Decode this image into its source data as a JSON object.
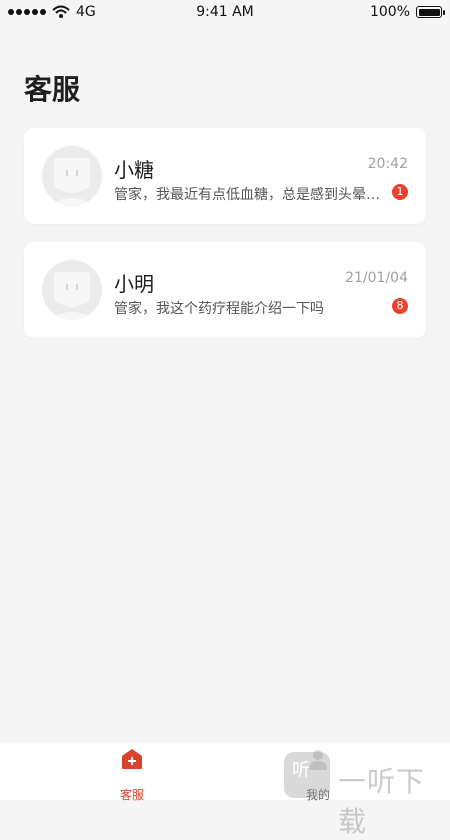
{
  "status_bar": {
    "carrier": "4G",
    "time": "9:41 AM",
    "battery_percent": "100%"
  },
  "header": {
    "title": "客服"
  },
  "conversations": [
    {
      "name": "小糖",
      "time": "20:42",
      "preview": "管家，我最近有点低血糖，总是感到头晕乏力",
      "unread": "1",
      "avatar_icon": "user-avatar-placeholder-icon"
    },
    {
      "name": "小明",
      "time": "21/01/04",
      "preview": "管家，我这个药疗程能介绍一下吗",
      "unread": "8",
      "avatar_icon": "user-avatar-placeholder-icon"
    }
  ],
  "tab_bar": {
    "tabs": [
      {
        "label": "客服",
        "icon": "service-home-icon",
        "active": true
      },
      {
        "label": "我的",
        "icon": "profile-icon",
        "active": false
      }
    ]
  },
  "watermark": {
    "icon_text": "听",
    "text": "一听下载"
  },
  "colors": {
    "accent": "#d9432d",
    "badge": "#e8432c",
    "background": "#f5f5f6",
    "card": "#ffffff"
  }
}
